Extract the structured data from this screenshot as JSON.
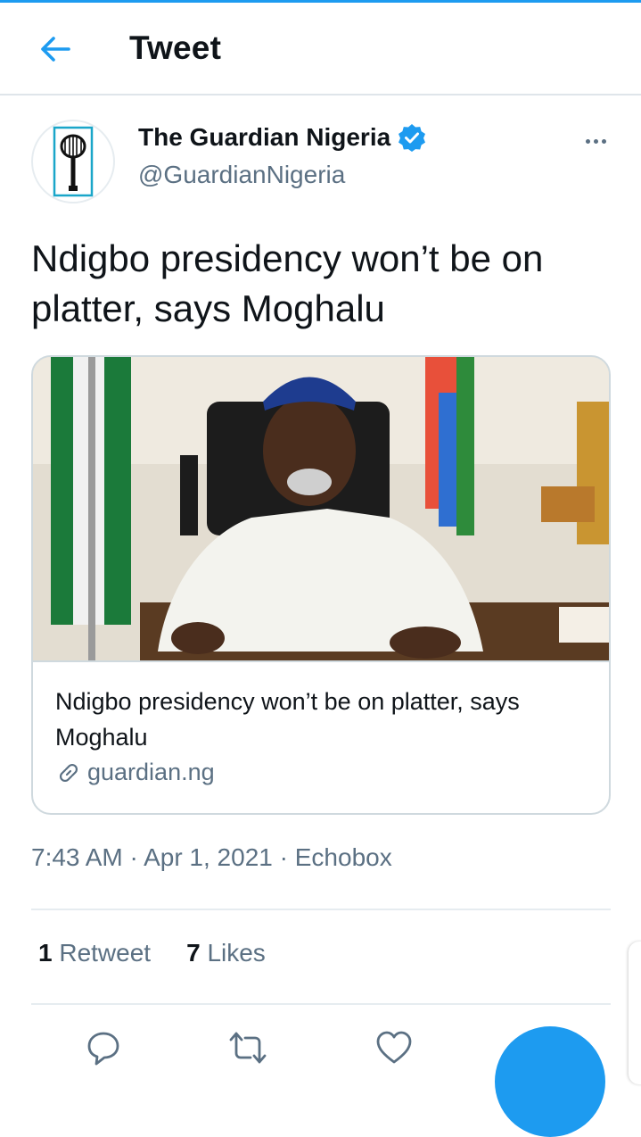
{
  "header": {
    "title": "Tweet",
    "back_icon": "arrow-left-icon"
  },
  "tweet": {
    "author": {
      "name": "The Guardian Nigeria",
      "handle": "@GuardianNigeria",
      "verified": true
    },
    "text": "Ndigbo presidency won’t be on platter, says Moghalu",
    "card": {
      "title": "Ndigbo presidency won’t be on platter, says Moghalu",
      "domain": "guardian.ng",
      "link_icon": "link-icon"
    },
    "meta": {
      "time": "7:43 AM",
      "date": "Apr 1, 2021",
      "source": "Echobox",
      "separator": "·"
    },
    "stats": {
      "retweets_count": "1",
      "retweets_label": "Retweet",
      "likes_count": "7",
      "likes_label": "Likes"
    }
  },
  "colors": {
    "accent": "#1d9bf0",
    "secondary_text": "#5b7083",
    "border": "#cfd9de"
  }
}
